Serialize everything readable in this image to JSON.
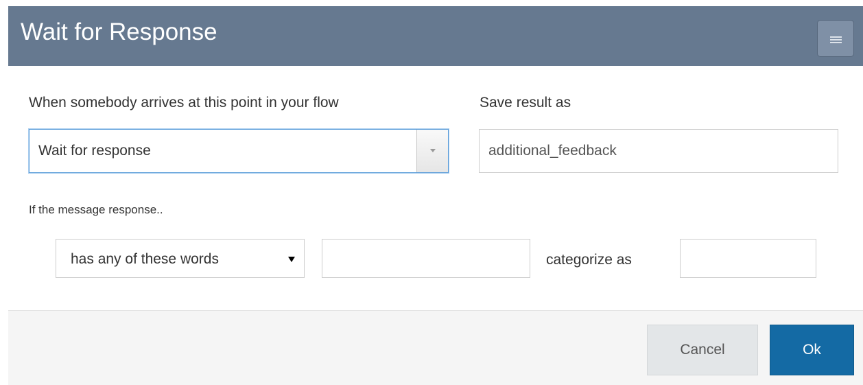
{
  "dialog": {
    "title": "Wait for Response",
    "menu_icon": "hamburger-icon"
  },
  "form": {
    "when_label": "When somebody arrives at this point in your flow",
    "action_select": {
      "selected": "Wait for response"
    },
    "save_label": "Save result as",
    "save_value": "additional_feedback",
    "if_label": "If the message response..",
    "rule": {
      "operator": "has any of these words",
      "words_value": "",
      "categorize_label": "categorize as",
      "category_value": ""
    }
  },
  "footer": {
    "cancel_label": "Cancel",
    "ok_label": "Ok"
  },
  "colors": {
    "header_bg": "#667990",
    "ok_bg": "#146aa4",
    "cancel_bg": "#e3e6e8",
    "focus_border": "#5b9dd9"
  }
}
